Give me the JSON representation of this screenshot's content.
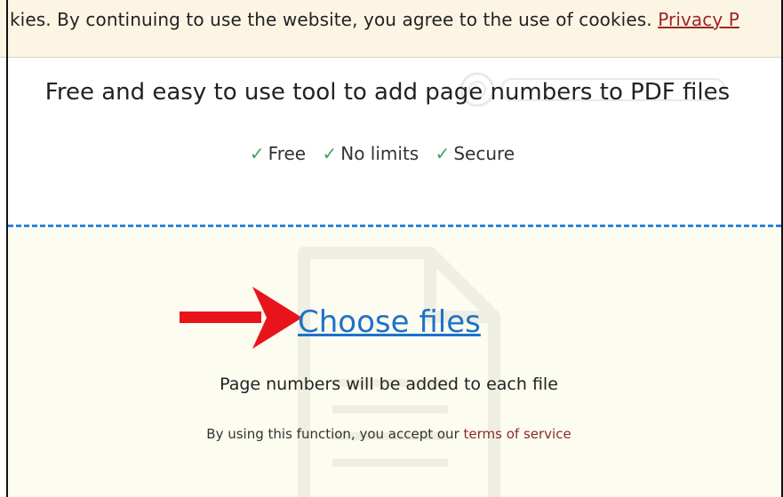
{
  "cookie_banner": {
    "text": "kies. By continuing to use the website, you agree to the use of cookies.",
    "link_label": "Privacy P"
  },
  "hero": {
    "headline": "Free and easy to use tool to add page numbers to PDF files",
    "features": [
      {
        "check": "✓",
        "label": "Free"
      },
      {
        "check": "✓",
        "label": "No limits"
      },
      {
        "check": "✓",
        "label": "Secure"
      }
    ]
  },
  "upload": {
    "choose_label": "Choose files",
    "info": "Page numbers will be added to each file",
    "tos_prefix": "By using this function, you accept our",
    "tos_link": "terms of service"
  },
  "colors": {
    "cookie_bg": "#fdf5e4",
    "drop_bg": "#fdfcf1",
    "dash": "#2a86d6",
    "link_blue": "#1d72c9",
    "check_green": "#3aa657",
    "arrow_red": "#e8141c",
    "tos_link": "#8c2a2a"
  }
}
